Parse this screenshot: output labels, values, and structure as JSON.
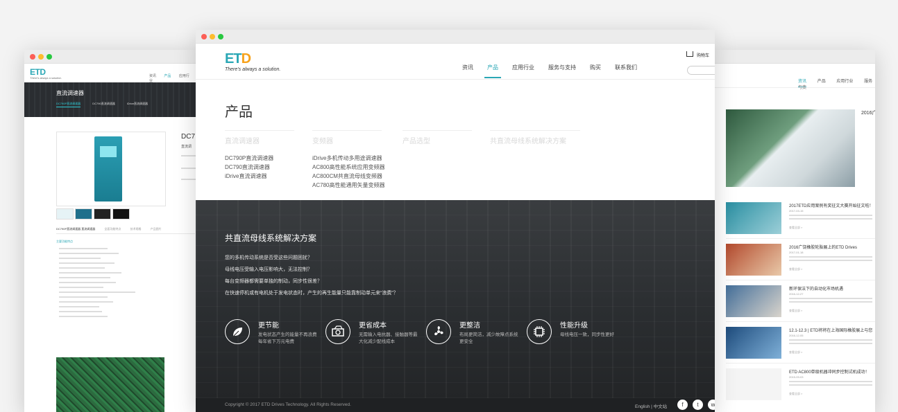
{
  "left_window": {
    "logo": "ETD",
    "tagline": "There's always a solution.",
    "nav": [
      "资讯",
      "产品",
      "应用行业"
    ],
    "banner_title": "直流调速器",
    "banner_tabs": [
      "DC790P直流调速器",
      "DC790直流调速器",
      "iDrive直流调速器"
    ],
    "product_heading": "DC7",
    "product_sub": "直流调",
    "detail_tabs": [
      "DC790P直流调速器 直流调速器",
      "全面功能特点",
      "技术规格",
      "产品图片",
      "其他资料"
    ],
    "section_label": "主要功能特点"
  },
  "main_window": {
    "logo_e": "E",
    "logo_t": "T",
    "logo_d": "D",
    "tagline": "There's always a solution.",
    "nav": [
      {
        "label": "资讯",
        "active": false
      },
      {
        "label": "产品",
        "active": true
      },
      {
        "label": "应用行业",
        "active": false
      },
      {
        "label": "服务与支持",
        "active": false
      },
      {
        "label": "购买",
        "active": false
      },
      {
        "label": "联系我们",
        "active": false
      }
    ],
    "cart_label": "购物车",
    "page_title": "产品",
    "categories": [
      {
        "heading": "直流调速器",
        "items": [
          "DC790P直流调速器",
          "DC790直流调速器",
          "iDrive直流调速器"
        ]
      },
      {
        "heading": "变频器",
        "items": [
          "iDrive多机传动多用途调速器",
          "AC800高性能系统应用变频器",
          "AC800CM共直流母线变频器",
          "AC780高性能通用矢量变频器"
        ]
      },
      {
        "heading": "产品选型",
        "items": []
      },
      {
        "heading": "共直流母线系统解决方案",
        "items": []
      }
    ],
    "solution": {
      "title": "共直流母线系统解决方案",
      "lines": [
        "您的多机传动系统是否受这些问题困扰？",
        "母线电压受输入电压影响大，无法控制？",
        "每台变频器都需要单独的制动，同步性很差？",
        "在快速停机或有电机处于发电状态时，产生的再生能量只能靠制动单元来“浪费”？"
      ],
      "features": [
        {
          "icon": "leaf-icon",
          "title": "更节能",
          "desc": "发电状态产生的能量不再浪费每年省下万元电费"
        },
        {
          "icon": "money-icon",
          "title": "更省成本",
          "desc": "无需输入电抗器、接触器等最大化减少配线成本"
        },
        {
          "icon": "fan-icon",
          "title": "更整洁",
          "desc": "布局更简洁，减少故障点系统更安全"
        },
        {
          "icon": "chip-icon",
          "title": "性能升级",
          "desc": "母线电压一致，同步性更好"
        }
      ]
    },
    "footer": {
      "copyright": "Copyright © 2017 ETD Drives Technology. All Rights Reserved.",
      "lang": "English | 中文站",
      "social": [
        "f",
        "t",
        "w"
      ]
    }
  },
  "right_window": {
    "nav": [
      {
        "label": "资讯",
        "active": true
      },
      {
        "label": "产品",
        "active": false
      },
      {
        "label": "应用行业",
        "active": false
      },
      {
        "label": "服务与支",
        "active": false
      }
    ],
    "feature_title": "2016广",
    "news": [
      {
        "title": "2017ETD应用案例有奖征文大赛开始征文啦！",
        "date": "2017-03-15",
        "more": "查看全部 »"
      },
      {
        "title": "2016广饶橡胶轮胎展上的ETD Drives",
        "date": "2017-01-18",
        "more": "查看全部 »"
      },
      {
        "title": "新环保法下的自动化市场机遇",
        "date": "2016-12-27",
        "more": "查看全部 »"
      },
      {
        "title": "12.1-12.3 | ETD将将在上海国际橡胶展上与您",
        "date": "2016-12-05",
        "more": "查看全部 »"
      },
      {
        "title": "ETD AC800单级机器冲同步控制试机成功！",
        "date": "2015-09-03",
        "more": "查看全部 »"
      }
    ]
  }
}
